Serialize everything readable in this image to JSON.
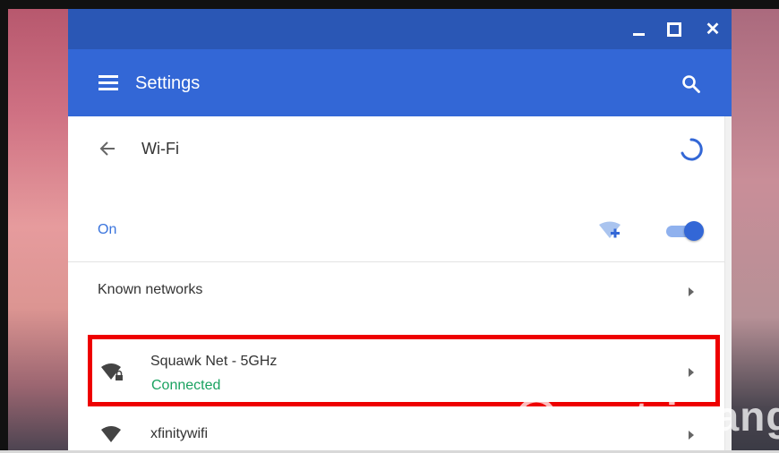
{
  "window": {
    "controls": {
      "minimize_icon": "minimize-icon",
      "maximize_icon": "maximize-icon",
      "close_glyph": "✕"
    }
  },
  "appbar": {
    "title": "Settings",
    "menu_icon": "hamburger-menu-icon",
    "search_icon": "search-icon",
    "color": "#3367d6"
  },
  "wifi_page": {
    "title": "Wi-Fi",
    "back_icon": "back-arrow-icon",
    "loading_icon": "spinner-icon",
    "state_label": "On",
    "toggle_on": true,
    "add_network_icon": "add-network-icon",
    "known_networks_label": "Known networks",
    "networks": [
      {
        "name": "Squawk Net - 5GHz",
        "status": "Connected",
        "secured": true,
        "highlighted": true
      },
      {
        "name": "xfinitywifi",
        "status": "",
        "secured": false,
        "highlighted": false
      }
    ]
  },
  "colors": {
    "accent": "#3367d6",
    "titlebar": "#2a57b5",
    "connected": "#1aa260",
    "highlight": "#ee0000"
  },
  "watermark": {
    "text": "uantrimang"
  }
}
